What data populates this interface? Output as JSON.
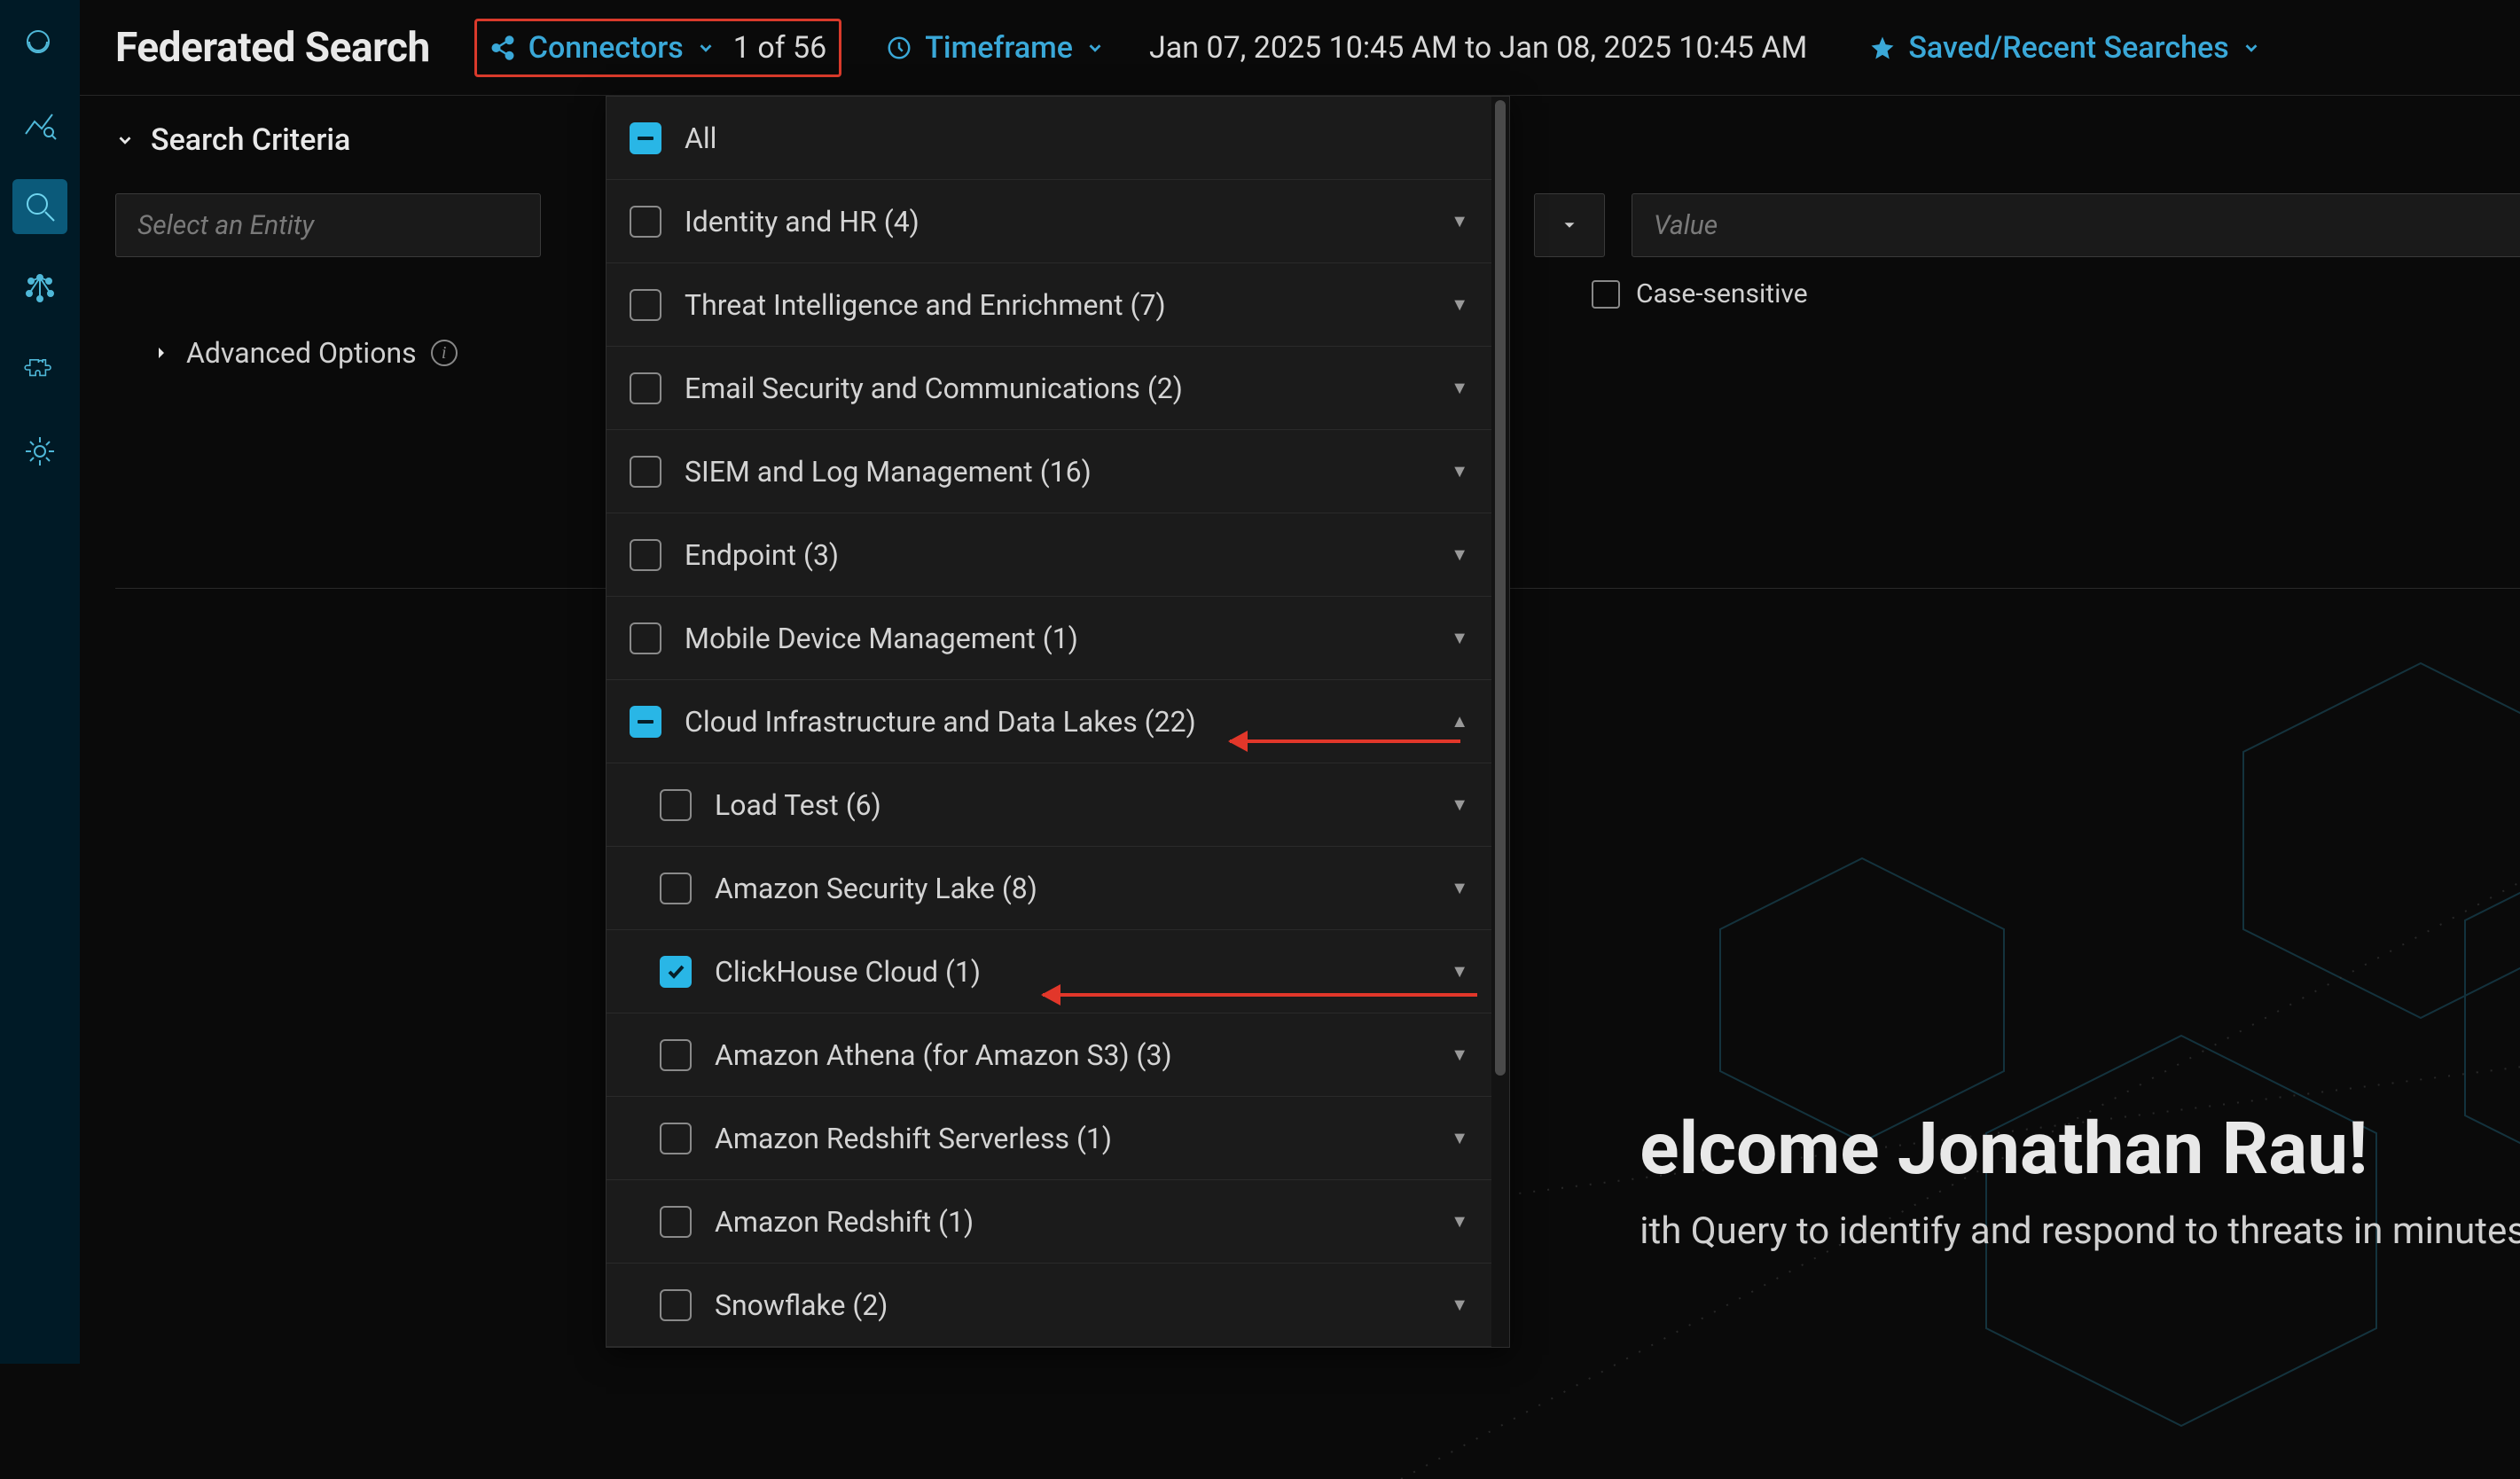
{
  "page_title": "Federated Search",
  "topbar": {
    "connectors_label": "Connectors",
    "connectors_count": "1 of 56",
    "timeframe_label": "Timeframe",
    "timerange": "Jan 07, 2025 10:45 AM to Jan 08, 2025 10:45 AM",
    "saved_label": "Saved/Recent Searches"
  },
  "criteria": {
    "header": "Search Criteria",
    "entity_placeholder": "Select an Entity",
    "value_placeholder": "Value",
    "advanced_label": "Advanced Options",
    "case_label": "Case-sensitive"
  },
  "welcome": {
    "title_partial": "elcome Jonathan Rau!",
    "subtitle_partial": "ith Query to identify and respond to threats in minutes."
  },
  "dropdown": {
    "all_label": "All",
    "groups": [
      {
        "label": "Identity and HR (4)"
      },
      {
        "label": "Threat Intelligence and Enrichment (7)"
      },
      {
        "label": "Email Security and Communications (2)"
      },
      {
        "label": "SIEM and Log Management (16)"
      },
      {
        "label": "Endpoint (3)"
      },
      {
        "label": "Mobile Device Management (1)"
      }
    ],
    "expanded_group": {
      "label": "Cloud Infrastructure and Data Lakes (22)"
    },
    "children": [
      {
        "label": "Load Test (6)"
      },
      {
        "label": "Amazon Security Lake (8)"
      },
      {
        "label": "ClickHouse Cloud (1)",
        "checked": true
      },
      {
        "label": "Amazon Athena (for Amazon S3) (3)"
      },
      {
        "label": "Amazon Redshift Serverless (1)"
      },
      {
        "label": "Amazon Redshift (1)"
      },
      {
        "label": "Snowflake (2)"
      }
    ]
  },
  "colors": {
    "accent": "#29b6e6",
    "annotation": "#e2372a"
  }
}
